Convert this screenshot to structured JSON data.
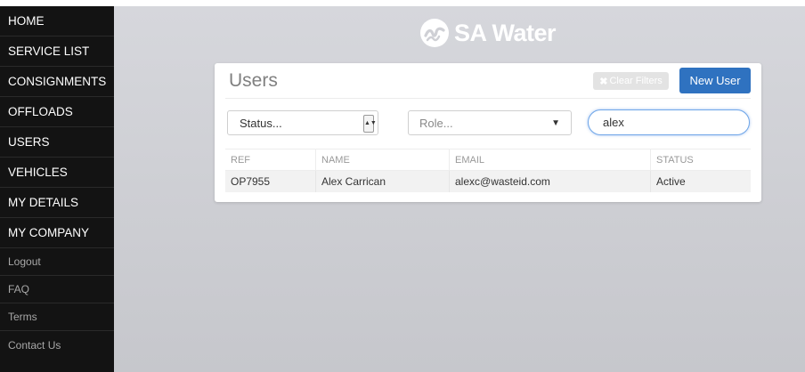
{
  "sidebar": {
    "main_items": [
      {
        "label": "HOME"
      },
      {
        "label": "SERVICE LIST"
      },
      {
        "label": "CONSIGNMENTS"
      },
      {
        "label": "OFFLOADS"
      },
      {
        "label": "USERS"
      },
      {
        "label": "VEHICLES"
      },
      {
        "label": "MY DETAILS"
      },
      {
        "label": "MY COMPANY"
      }
    ],
    "secondary_items": [
      {
        "label": "Logout"
      },
      {
        "label": "FAQ"
      },
      {
        "label": "Terms"
      },
      {
        "label": "Contact Us"
      }
    ]
  },
  "brand": {
    "name": "SA Water",
    "logo_icon": "sa-water-wave-logo"
  },
  "card": {
    "title": "Users",
    "clear_filters_label": "Clear Filters",
    "new_user_label": "New User",
    "filters": {
      "status_value": "Status...",
      "role_placeholder": "Role...",
      "search_value": "alex"
    },
    "table": {
      "columns": [
        "REF",
        "NAME",
        "EMAIL",
        "STATUS"
      ],
      "rows": [
        {
          "ref": "OP7955",
          "name": "Alex Carrican",
          "email": "alexc@wasteid.com",
          "status": "Active"
        }
      ]
    }
  },
  "colors": {
    "sidebar_bg": "#131313",
    "primary_button": "#2f72c0",
    "disabled_button": "#e3e3e3",
    "main_bg": "#cfd0d5"
  }
}
